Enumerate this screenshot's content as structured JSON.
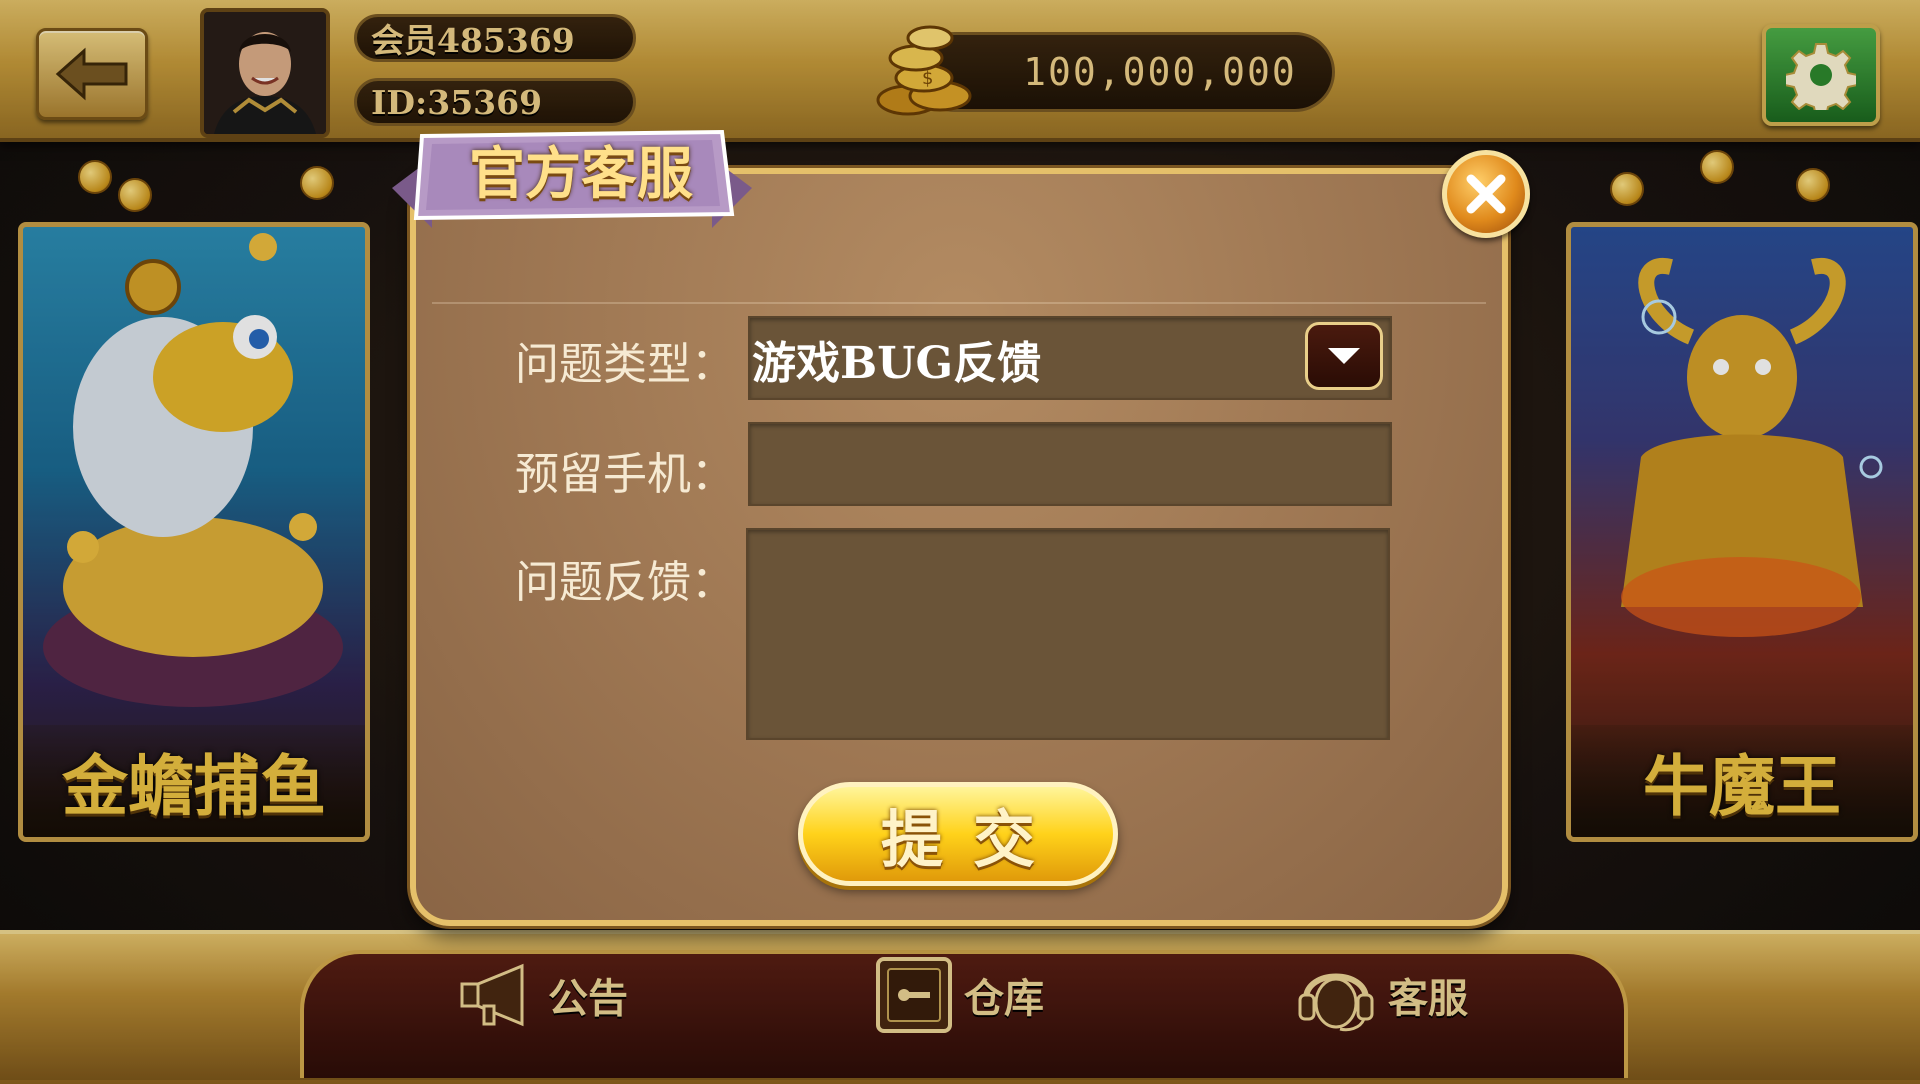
{
  "header": {
    "member_label": "会员485369",
    "id_label": "ID:35369",
    "coins": "100,000,000"
  },
  "icons": {
    "back": "back-arrow-icon",
    "settings": "gear-icon",
    "close": "close-icon",
    "dropdown": "chevron-down-icon",
    "coins": "coin-stack-icon",
    "announcement": "megaphone-icon",
    "warehouse": "safe-icon",
    "service": "headset-icon"
  },
  "games": {
    "left_name": "金蟾捕鱼",
    "right_name": "牛魔王"
  },
  "dialog": {
    "title": "官方客服",
    "type_label": "问题类型：",
    "type_value": "游戏BUG反馈",
    "phone_label": "预留手机：",
    "phone_value": "",
    "feedback_label": "问题反馈：",
    "feedback_value": "",
    "submit_label": "提交"
  },
  "bottom_nav": {
    "announcement": "公告",
    "warehouse": "仓库",
    "service": "客服"
  },
  "colors": {
    "gold": "#e5c06a",
    "dialog_bg": "#9d7652",
    "field_bg": "#6a5438",
    "settings_green": "#2e8a2e",
    "submit_yellow": "#ffd21a",
    "close_orange": "#e08a1c"
  }
}
